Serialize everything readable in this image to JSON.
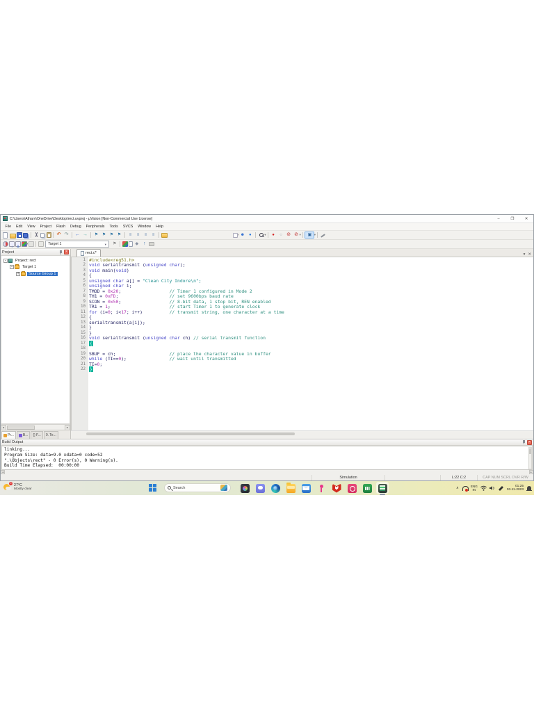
{
  "window": {
    "title": "C:\\Users\\Atharv\\OneDrive\\Desktop\\rect.uvproj - µVision  [Non-Commercial Use License]",
    "controls": {
      "minimize": "–",
      "maximize": "❐",
      "close": "✕"
    },
    "menu": [
      "File",
      "Edit",
      "View",
      "Project",
      "Flash",
      "Debug",
      "Peripherals",
      "Tools",
      "SVCS",
      "Window",
      "Help"
    ]
  },
  "toolbar1": {
    "icons": [
      "new",
      "open",
      "save",
      "saveall",
      "|",
      "cut",
      "copy",
      "paste",
      "|",
      "undo",
      "redo",
      "|",
      "back",
      "fwd",
      "|",
      "flag",
      "flag",
      "flag",
      "flag",
      "|",
      "indent",
      "indent",
      "indent",
      "indent",
      "|",
      "editbox",
      "gap",
      "checkdd",
      "person",
      "ball",
      "|",
      "finddd",
      "|",
      "bpred",
      "bpgray",
      "bpdis",
      "bpdisdd",
      "|",
      "winddActive",
      "|",
      "wrench"
    ]
  },
  "toolbar2": {
    "icons_left": [
      "translate",
      "build",
      "rebuild",
      "batchdddd",
      "stopg",
      "|",
      "download"
    ],
    "target_select": "Target 1",
    "icons_right": [
      "kflag",
      "|",
      "cube",
      "paper",
      "diamond",
      "up",
      "pack"
    ]
  },
  "project_panel": {
    "title": "Project",
    "tree": [
      {
        "label": "Project: rect",
        "level": 0,
        "expander": "-",
        "icon": "chip",
        "selected": false
      },
      {
        "label": "Target 1",
        "level": 1,
        "expander": "-",
        "icon": "folder",
        "selected": false
      },
      {
        "label": "Source Group 1",
        "level": 2,
        "expander": "+",
        "icon": "folder",
        "selected": true
      }
    ],
    "tabs": [
      {
        "label": "Pr...",
        "active": true,
        "dot": "#e8a030"
      },
      {
        "label": "B...",
        "active": false,
        "dot": "#7a5ad8"
      },
      {
        "label": "{} F...",
        "active": false,
        "dot": ""
      },
      {
        "label": "0. Te...",
        "active": false,
        "dot": ""
      }
    ]
  },
  "editor": {
    "tab_label": "rect.c*",
    "lines": [
      {
        "n": "1",
        "segs": [
          [
            "#include<reg51.h>",
            "pre"
          ]
        ]
      },
      {
        "n": "2",
        "segs": [
          [
            "void ",
            "kw"
          ],
          [
            "serialtransmit (",
            "pl"
          ],
          [
            "unsigned char",
            "kw"
          ],
          [
            ");",
            "pl"
          ]
        ]
      },
      {
        "n": "3",
        "segs": [
          [
            "void ",
            "kw"
          ],
          [
            "main(",
            "pl"
          ],
          [
            "void",
            "kw"
          ],
          [
            ")",
            "pl"
          ]
        ]
      },
      {
        "n": "4",
        "segs": [
          [
            "{",
            "pl"
          ]
        ]
      },
      {
        "n": "5",
        "segs": [
          [
            "unsigned char",
            "kw"
          ],
          [
            " a[] = ",
            "pl"
          ],
          [
            "\"Clean City Indore\\n\";",
            "str"
          ]
        ]
      },
      {
        "n": "6",
        "segs": [
          [
            "unsigned char",
            "kw"
          ],
          [
            " i;",
            "pl"
          ]
        ]
      },
      {
        "n": "7",
        "segs": [
          [
            "TMOD = ",
            "pl"
          ],
          [
            "0x20",
            "num"
          ],
          [
            ";",
            "pl"
          ],
          [
            "                  // Timer 1 configured in Mode 2",
            "com"
          ]
        ]
      },
      {
        "n": "8",
        "segs": [
          [
            "TH1 = ",
            "pl"
          ],
          [
            "0xFD",
            "num"
          ],
          [
            ";",
            "pl"
          ],
          [
            "                   // set 9600bps baud rate",
            "com"
          ]
        ]
      },
      {
        "n": "9",
        "segs": [
          [
            "SCON = ",
            "pl"
          ],
          [
            "0x50",
            "num"
          ],
          [
            ";",
            "pl"
          ],
          [
            "                  // 8-bit data, 1 stop bit, REN enabled",
            "com"
          ]
        ]
      },
      {
        "n": "10",
        "segs": [
          [
            "TR1 = ",
            "pl"
          ],
          [
            "1",
            "num"
          ],
          [
            ";",
            "pl"
          ],
          [
            "                      // start Timer 1 to generate clock",
            "com"
          ]
        ]
      },
      {
        "n": "11",
        "segs": [
          [
            "for",
            "kw"
          ],
          [
            " (i=",
            "pl"
          ],
          [
            "0",
            "num"
          ],
          [
            "; i<",
            "pl"
          ],
          [
            "17",
            "num"
          ],
          [
            "; i++)",
            "pl"
          ],
          [
            "          // transmit string, one character at a time",
            "com"
          ]
        ]
      },
      {
        "n": "12",
        "segs": [
          [
            "{",
            "pl"
          ]
        ]
      },
      {
        "n": "13",
        "segs": [
          [
            "serialtransmit(a[i]);",
            "pl"
          ]
        ]
      },
      {
        "n": "14",
        "segs": [
          [
            "}",
            "pl"
          ]
        ]
      },
      {
        "n": "15",
        "segs": [
          [
            "}",
            "pl"
          ]
        ]
      },
      {
        "n": "16",
        "segs": [
          [
            "void ",
            "kw"
          ],
          [
            "serialtransmit (",
            "pl"
          ],
          [
            "unsigned char",
            "kw"
          ],
          [
            " ch) ",
            "pl"
          ],
          [
            "// serial transmit function",
            "com"
          ]
        ]
      },
      {
        "n": "17",
        "segs": [
          [
            "{",
            "hl"
          ]
        ]
      },
      {
        "n": "18",
        "segs": []
      },
      {
        "n": "19",
        "segs": [
          [
            "SBUF = ch;",
            "pl"
          ],
          [
            "                    // place the character value in buffer",
            "com"
          ]
        ]
      },
      {
        "n": "20",
        "segs": [
          [
            "while",
            "kw"
          ],
          [
            " (TI==",
            "pl"
          ],
          [
            "0",
            "num"
          ],
          [
            ");",
            "pl"
          ],
          [
            "                // wait until transmitted",
            "com"
          ]
        ]
      },
      {
        "n": "21",
        "segs": [
          [
            "TI=",
            "pl"
          ],
          [
            "0",
            "num"
          ],
          [
            ";",
            "pl"
          ]
        ]
      },
      {
        "n": "22",
        "segs": [
          [
            "}",
            "hl"
          ]
        ]
      }
    ]
  },
  "build_output": {
    "title": "Build Output",
    "lines": [
      "linking...",
      "Program Size: data=9.0 xdata=0 code=52",
      "\".\\Objects\\rect\" - 0 Error(s), 0 Warning(s).",
      "Build Time Elapsed:  00:00:00"
    ]
  },
  "status_bar": {
    "mode": "Simulation",
    "cursor": "L:22 C:2",
    "flags": "CAP NUM SCRL OVR R/W"
  },
  "taskbar": {
    "weather": {
      "temp": "27°C",
      "desc": "Mostly clear"
    },
    "search_placeholder": "Search",
    "apps": [
      "photos",
      "chat",
      "edge",
      "explorer",
      "mail",
      "share",
      "mcafee",
      "clipchamp",
      "excel",
      "keil"
    ],
    "active_app": "keil",
    "tray": {
      "language_line1": "ENG",
      "language_line2": "IN",
      "time": "01:25",
      "date": "03-11-2023"
    }
  }
}
